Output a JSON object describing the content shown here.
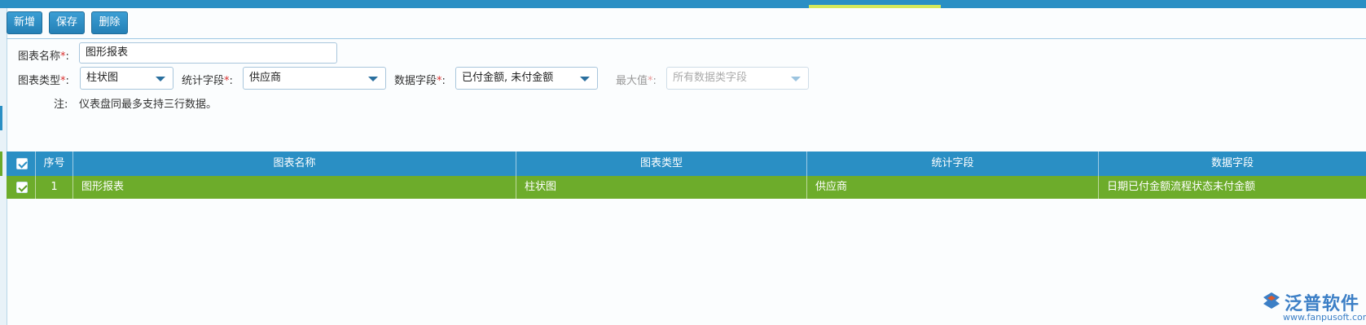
{
  "toolbar": {
    "add_label": "新增",
    "save_label": "保存",
    "delete_label": "删除"
  },
  "form": {
    "chart_name": {
      "label": "图表名称",
      "required_mark": "*",
      "colon": ":",
      "value": "图形报表"
    },
    "chart_type": {
      "label": "图表类型",
      "required_mark": "*",
      "colon": ":",
      "value": "柱状图"
    },
    "stat_field": {
      "label": "统计字段",
      "required_mark": "*",
      "colon": ":",
      "value": "供应商"
    },
    "data_field": {
      "label": "数据字段",
      "required_mark": "*",
      "colon": ":",
      "value": "已付金额, 未付金额"
    },
    "max_value": {
      "label": "最大值",
      "required_mark": "*",
      "colon": ":",
      "placeholder": "所有数据类字段"
    },
    "note": {
      "label": "注:",
      "text": "仪表盘同最多支持三行数据。"
    }
  },
  "grid": {
    "columns": [
      "序号",
      "图表名称",
      "图表类型",
      "统计字段",
      "数据字段"
    ],
    "rows": [
      {
        "index": "1",
        "chart_name": "图形报表",
        "chart_type": "柱状图",
        "stat_field": "供应商",
        "data_field": "日期已付金额流程状态未付金额"
      }
    ],
    "header_color": "#2a8fc4",
    "selected_row_color": "#6dac2b"
  },
  "logo": {
    "name": "泛普软件",
    "url": "www.fanpusoft.com",
    "icon": "fanpu-logo-icon"
  }
}
